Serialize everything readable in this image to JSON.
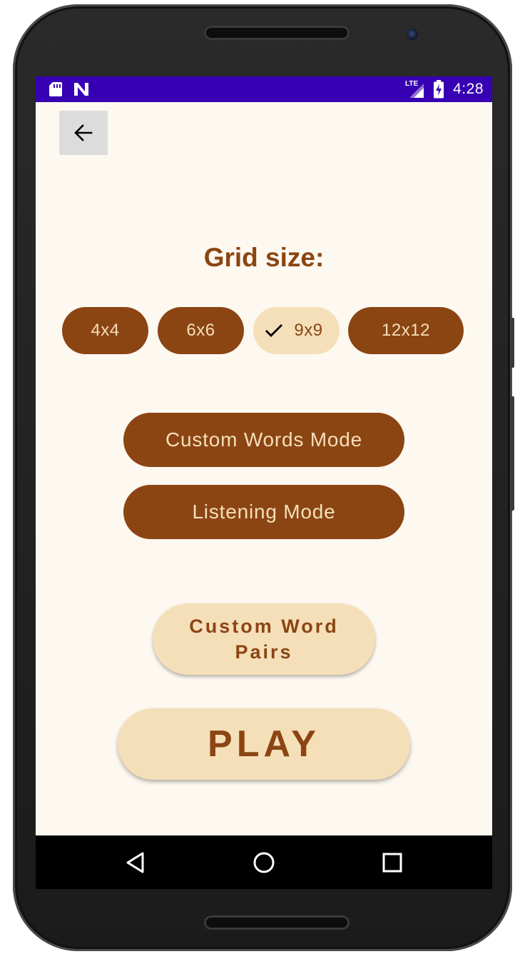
{
  "status_bar": {
    "time": "4:28",
    "network_label": "LTE",
    "icons": [
      "sd-card-icon",
      "n-notification-icon",
      "lte-signal-icon",
      "battery-charging-icon"
    ]
  },
  "toolbar": {
    "back_icon": "arrow-left-icon"
  },
  "grid_size": {
    "title": "Grid size:",
    "options": [
      {
        "label": "4x4",
        "selected": false
      },
      {
        "label": "6x6",
        "selected": false
      },
      {
        "label": "9x9",
        "selected": true
      },
      {
        "label": "12x12",
        "selected": false
      }
    ]
  },
  "modes": {
    "custom_words_label": "Custom Words Mode",
    "listening_label": "Listening Mode"
  },
  "actions": {
    "custom_pairs_label": "Custom Word Pairs",
    "play_label": "PLAY"
  },
  "nav_bar": {
    "icons": [
      "back-triangle-icon",
      "home-circle-icon",
      "recents-square-icon"
    ]
  },
  "colors": {
    "accent_brown": "#8b4513",
    "light_beige": "#f5dfb9",
    "background": "#fdf8f0",
    "status_bar": "#3700b3"
  }
}
